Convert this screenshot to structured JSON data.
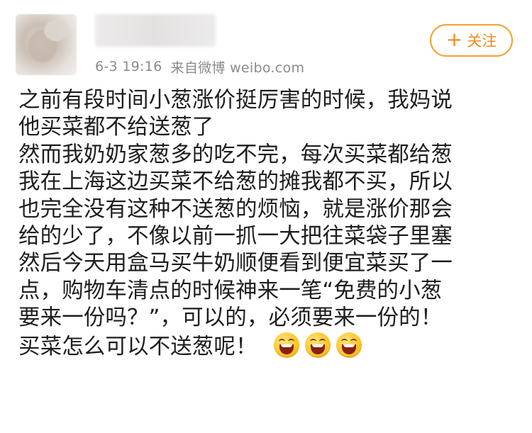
{
  "post": {
    "meta": {
      "time": "6-3 19:16",
      "source": "来自微博 weibo.com"
    },
    "follow_button": {
      "icon": "plus-icon",
      "label": "关注"
    },
    "lines": [
      "之前有段时间小葱涨价挺厉害的时候，我妈说",
      "他买菜都不给送葱了",
      "然而我奶奶家葱多的吃不完，每次买菜都给葱",
      "我在上海这边买菜不给葱的摊我都不买，所以",
      "也完全没有这种不送葱的烦恼，就是涨价那会",
      "给的少了，不像以前一抓一大把往菜袋子里塞",
      "然后今天用盒马买牛奶顺便看到便宜菜买了一",
      "点，购物车清点的时候神来一笔“免费的小葱",
      "要来一份吗？”，可以的，必须要来一份的！",
      "买菜怎么可以不送葱呢！"
    ],
    "emojis": [
      "laughing-face-icon",
      "laughing-face-icon",
      "laughing-face-icon"
    ],
    "colors": {
      "accent": "#f28a1d",
      "meta_text": "#8a8a8a",
      "body_text": "#1e1e1e"
    }
  }
}
